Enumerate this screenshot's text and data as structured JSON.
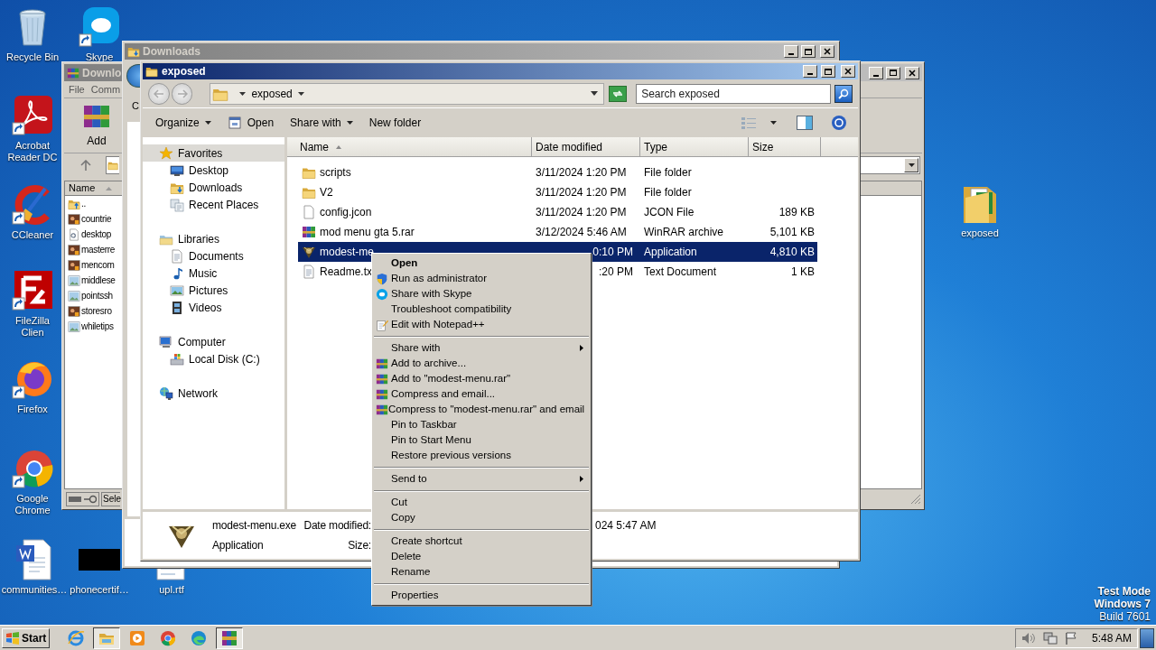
{
  "desktop_icons": [
    {
      "label": "Recycle Bin",
      "kind": "recycle"
    },
    {
      "label": "Skype",
      "kind": "skype"
    },
    {
      "label": "Acrobat Reader DC",
      "kind": "acrobat"
    },
    {
      "label": "CCleaner",
      "kind": "ccleaner"
    },
    {
      "label": "FileZilla Clien",
      "kind": "filezilla"
    },
    {
      "label": "Firefox",
      "kind": "firefox"
    },
    {
      "label": "Google Chrome",
      "kind": "chrome"
    },
    {
      "label": "communities…",
      "kind": "word"
    },
    {
      "label": "phonecertif…",
      "kind": "thumbnail"
    },
    {
      "label": "upl.rtf",
      "kind": "rtf"
    },
    {
      "label": "exposed",
      "kind": "folder"
    }
  ],
  "archiver_window": {
    "title": "Downlo",
    "menu": [
      "File",
      "Comm"
    ],
    "toolbar": [
      "Add"
    ],
    "column": "Name",
    "status": "Sele",
    "files": [
      {
        "name": "..",
        "kind": "up"
      },
      {
        "name": "countrie",
        "kind": "photo"
      },
      {
        "name": "desktop",
        "kind": "settings"
      },
      {
        "name": "masterre",
        "kind": "photo"
      },
      {
        "name": "mencom",
        "kind": "photo"
      },
      {
        "name": "middlese",
        "kind": "image"
      },
      {
        "name": "pointssh",
        "kind": "image"
      },
      {
        "name": "storesro",
        "kind": "photo"
      },
      {
        "name": "whiletips",
        "kind": "image"
      }
    ]
  },
  "downloads_window": {
    "title": "Downloads",
    "toolbar_fragment": "C"
  },
  "explorer": {
    "title": "exposed",
    "breadcrumb": "exposed",
    "search": {
      "placeholder": "Search exposed"
    },
    "commands": [
      {
        "label": "Organize",
        "kind": "menu"
      },
      {
        "label": "Open",
        "kind": "open"
      },
      {
        "label": "Share with",
        "kind": "menu"
      },
      {
        "label": "New folder",
        "kind": "plain"
      }
    ],
    "nav": [
      {
        "label": "Favorites",
        "kind": "star",
        "selected": true,
        "children": [
          {
            "label": "Desktop",
            "kind": "desktop",
            "selected": false
          },
          {
            "label": "Downloads",
            "kind": "downloads",
            "selected": false
          },
          {
            "label": "Recent Places",
            "kind": "recent",
            "selected": false
          }
        ]
      },
      {
        "label": "Libraries",
        "kind": "library",
        "selected": false,
        "children": [
          {
            "label": "Documents",
            "kind": "documents",
            "selected": false
          },
          {
            "label": "Music",
            "kind": "music",
            "selected": false
          },
          {
            "label": "Pictures",
            "kind": "pictures",
            "selected": false
          },
          {
            "label": "Videos",
            "kind": "videos",
            "selected": false
          }
        ]
      },
      {
        "label": "Computer",
        "kind": "computer",
        "selected": false,
        "children": [
          {
            "label": "Local Disk (C:)",
            "kind": "disk",
            "selected": false
          }
        ]
      },
      {
        "label": "Network",
        "kind": "network",
        "selected": false
      }
    ],
    "columns": [
      {
        "label": "Name",
        "sorted": true
      },
      {
        "label": "Date modified",
        "sorted": false
      },
      {
        "label": "Type",
        "sorted": false
      },
      {
        "label": "Size",
        "sorted": false
      }
    ],
    "rows": [
      {
        "name": "scripts",
        "date": "3/11/2024 1:20 PM",
        "type": "File folder",
        "kind": "folder",
        "selected": false,
        "covered": false
      },
      {
        "name": "V2",
        "date": "3/11/2024 1:20 PM",
        "type": "File folder",
        "kind": "folder",
        "selected": false,
        "covered": false
      },
      {
        "name": "config.jcon",
        "date": "3/11/2024 1:20 PM",
        "type": "JCON File",
        "size": "189 KB",
        "kind": "file",
        "selected": false,
        "covered": false
      },
      {
        "name": "mod menu gta 5.rar",
        "date": "3/12/2024 5:46 AM",
        "type": "WinRAR archive",
        "size": "5,101 KB",
        "kind": "rar",
        "selected": false,
        "covered": false
      },
      {
        "name": "modest-me",
        "date": "0:10 PM",
        "type": "Application",
        "size": "4,810 KB",
        "kind": "app",
        "selected": true,
        "covered": true
      },
      {
        "name": "Readme.tx",
        "date": ":20 PM",
        "type": "Text Document",
        "size": "1 KB",
        "kind": "text",
        "selected": false,
        "covered": true
      }
    ],
    "details": {
      "name": "modest-menu.exe",
      "type": "Application",
      "fields": [
        {
          "label": "Date modified:",
          "value": "024 5:47 AM"
        },
        {
          "label": "Size:"
        }
      ]
    }
  },
  "context_menu": [
    {
      "label": "Open",
      "kind": "default"
    },
    {
      "label": "Run as administrator",
      "kind": "elevated"
    },
    {
      "label": "Share with Skype",
      "kind": "share_app"
    },
    {
      "label": "Troubleshoot compatibility",
      "kind": "plain"
    },
    {
      "label": "Edit with Notepad++",
      "kind": "editor"
    },
    {
      "kind": "separator"
    },
    {
      "label": "Share with",
      "kind": "submenu"
    },
    {
      "label": "Add to archive...",
      "kind": "archiver"
    },
    {
      "label": "Add to \"modest-menu.rar\"",
      "kind": "archiver"
    },
    {
      "label": "Compress and email...",
      "kind": "archiver"
    },
    {
      "label": "Compress to \"modest-menu.rar\" and email",
      "kind": "archiver"
    },
    {
      "label": "Pin to Taskbar",
      "kind": "plain"
    },
    {
      "label": "Pin to Start Menu",
      "kind": "plain"
    },
    {
      "label": "Restore previous versions",
      "kind": "plain"
    },
    {
      "kind": "separator"
    },
    {
      "label": "Send to",
      "kind": "submenu"
    },
    {
      "kind": "separator"
    },
    {
      "label": "Cut",
      "kind": "plain"
    },
    {
      "label": "Copy",
      "kind": "plain"
    },
    {
      "kind": "separator"
    },
    {
      "label": "Create shortcut",
      "kind": "plain"
    },
    {
      "label": "Delete",
      "kind": "plain"
    },
    {
      "label": "Rename",
      "kind": "plain"
    },
    {
      "kind": "separator"
    },
    {
      "label": "Properties",
      "kind": "plain"
    }
  ],
  "system_notice": [
    "Test Mode",
    "Windows 7",
    "Build 7601"
  ],
  "taskbar": {
    "start": "Start",
    "time": "5:48 AM",
    "apps": [
      {
        "kind": "ie",
        "active": false
      },
      {
        "kind": "explorer",
        "active": true
      },
      {
        "kind": "media",
        "active": false
      },
      {
        "kind": "chrome",
        "active": false
      },
      {
        "kind": "edge",
        "active": false
      },
      {
        "kind": "archiver",
        "active": true
      }
    ]
  }
}
